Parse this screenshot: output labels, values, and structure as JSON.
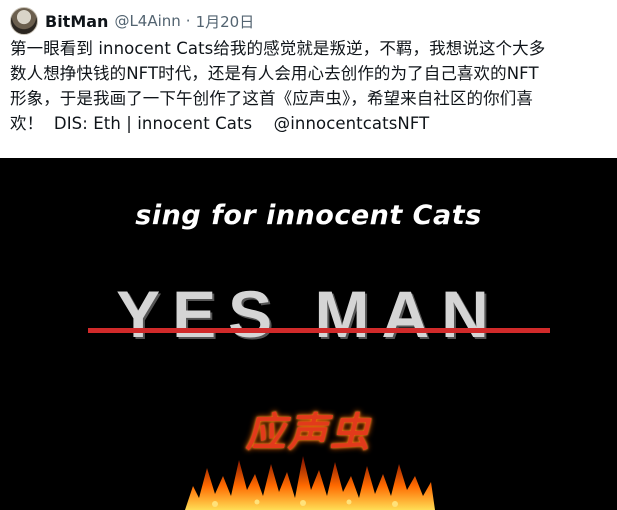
{
  "tweet": {
    "display_name": "BitMan",
    "handle": "@L4Ainn",
    "separator": "·",
    "date": "1月20日",
    "text": "第一眼看到 innocent Cats给我的感觉就是叛逆，不羁，我想说这个大多\n数人想挣快钱的NFT时代，还是有人会用心去创作的为了自己喜欢的NFT\n形象，于是我画了一下午创作了这首《应声虫》，希望来自社区的你们喜\n欢！  DIS: Eth | innocent Cats    @innocentcatsNFT"
  },
  "media": {
    "subtitle": "sing for innocent Cats",
    "title": "YES MAN",
    "title_zh": "应声虫",
    "colors": {
      "background": "#000000",
      "strike": "#d12a2a",
      "fire": "#ff5a00"
    }
  }
}
